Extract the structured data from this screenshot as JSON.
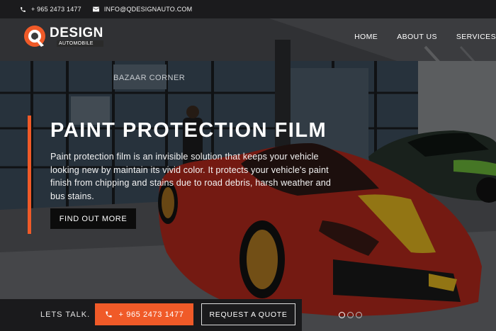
{
  "topbar": {
    "phone": "+ 965 2473 1477",
    "email": "INFO@QDESIGNAUTO.COM"
  },
  "logo": {
    "main": "DESIGN",
    "sub": "AUTOMOBILE"
  },
  "nav": {
    "items": [
      "HOME",
      "ABOUT US",
      "SERVICES"
    ]
  },
  "hero": {
    "title": "PAINT PROTECTION FILM",
    "description": "Paint protection film is an invisible solution that keeps your vehicle looking new by maintain its vivid color. It protects your vehicle's paint finish from chipping and stains due to road debris, harsh weather and bus stains.",
    "cta_label": "FIND OUT MORE",
    "background_sign": "BAZAAR CORNER"
  },
  "bottom": {
    "lets_talk": "LETS TALK.",
    "phone_label": "+ 965 2473 1477",
    "quote_label": "REQUEST A QUOTE"
  },
  "slider": {
    "count": 3,
    "active": 0
  },
  "colors": {
    "accent": "#f05a28",
    "dark": "#1a1a1c",
    "car_red": "#c0281c",
    "car_stripe": "#f0c419"
  }
}
